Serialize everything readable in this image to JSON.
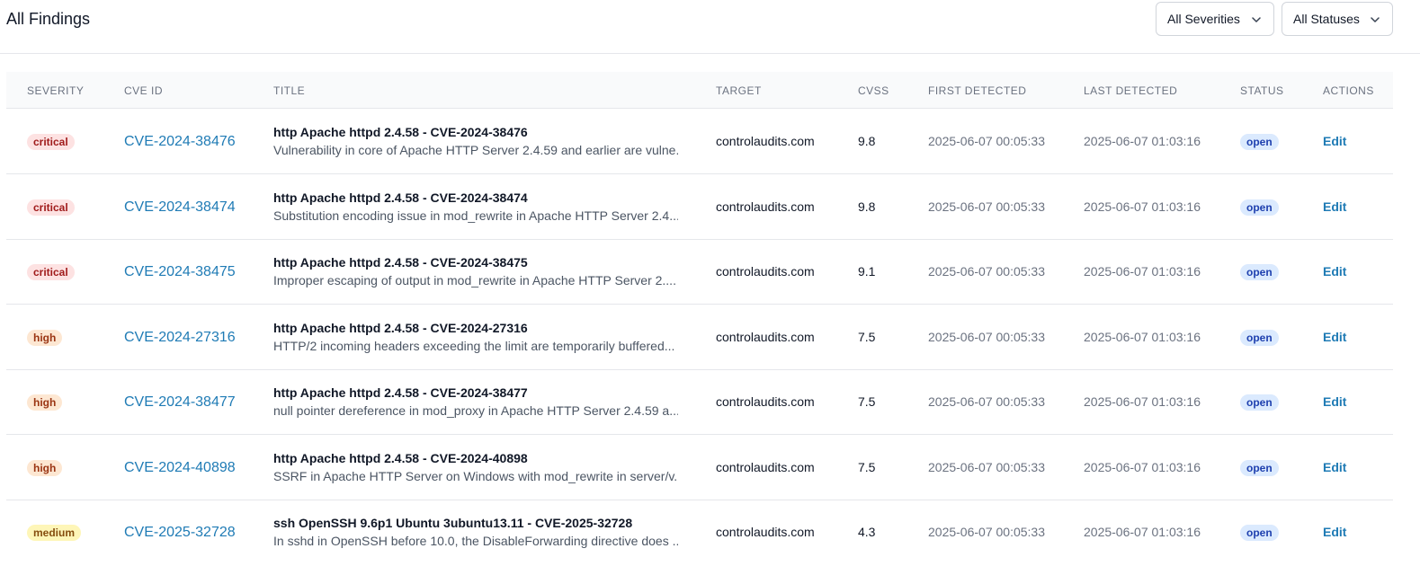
{
  "page": {
    "title": "All Findings"
  },
  "filters": {
    "severity": "All Severities",
    "status": "All Statuses"
  },
  "columns": {
    "severity": "SEVERITY",
    "cve_id": "CVE ID",
    "title": "TITLE",
    "target": "TARGET",
    "cvss": "CVSS",
    "first_detected": "FIRST DETECTED",
    "last_detected": "LAST DETECTED",
    "status": "STATUS",
    "actions": "ACTIONS"
  },
  "rows": [
    {
      "severity": "critical",
      "cve": "CVE-2024-38476",
      "title": "http Apache httpd 2.4.58 - CVE-2024-38476",
      "desc": "Vulnerability in core of Apache HTTP Server 2.4.59 and earlier are vulne...",
      "target": "controlaudits.com",
      "cvss": "9.8",
      "first": "2025-06-07 00:05:33",
      "last": "2025-06-07 01:03:16",
      "status": "open",
      "action": "Edit"
    },
    {
      "severity": "critical",
      "cve": "CVE-2024-38474",
      "title": "http Apache httpd 2.4.58 - CVE-2024-38474",
      "desc": "Substitution encoding issue in mod_rewrite in Apache HTTP Server 2.4....",
      "target": "controlaudits.com",
      "cvss": "9.8",
      "first": "2025-06-07 00:05:33",
      "last": "2025-06-07 01:03:16",
      "status": "open",
      "action": "Edit"
    },
    {
      "severity": "critical",
      "cve": "CVE-2024-38475",
      "title": "http Apache httpd 2.4.58 - CVE-2024-38475",
      "desc": "Improper escaping of output in mod_rewrite in Apache HTTP Server 2....",
      "target": "controlaudits.com",
      "cvss": "9.1",
      "first": "2025-06-07 00:05:33",
      "last": "2025-06-07 01:03:16",
      "status": "open",
      "action": "Edit"
    },
    {
      "severity": "high",
      "cve": "CVE-2024-27316",
      "title": "http Apache httpd 2.4.58 - CVE-2024-27316",
      "desc": "HTTP/2 incoming headers exceeding the limit are temporarily buffered...",
      "target": "controlaudits.com",
      "cvss": "7.5",
      "first": "2025-06-07 00:05:33",
      "last": "2025-06-07 01:03:16",
      "status": "open",
      "action": "Edit"
    },
    {
      "severity": "high",
      "cve": "CVE-2024-38477",
      "title": "http Apache httpd 2.4.58 - CVE-2024-38477",
      "desc": "null pointer dereference in mod_proxy in Apache HTTP Server 2.4.59 a...",
      "target": "controlaudits.com",
      "cvss": "7.5",
      "first": "2025-06-07 00:05:33",
      "last": "2025-06-07 01:03:16",
      "status": "open",
      "action": "Edit"
    },
    {
      "severity": "high",
      "cve": "CVE-2024-40898",
      "title": "http Apache httpd 2.4.58 - CVE-2024-40898",
      "desc": "SSRF in Apache HTTP Server on Windows with mod_rewrite in server/v...",
      "target": "controlaudits.com",
      "cvss": "7.5",
      "first": "2025-06-07 00:05:33",
      "last": "2025-06-07 01:03:16",
      "status": "open",
      "action": "Edit"
    },
    {
      "severity": "medium",
      "cve": "CVE-2025-32728",
      "title": "ssh OpenSSH 9.6p1 Ubuntu 3ubuntu13.11 - CVE-2025-32728",
      "desc": "In sshd in OpenSSH before 10.0, the DisableForwarding directive does ...",
      "target": "controlaudits.com",
      "cvss": "4.3",
      "first": "2025-06-07 00:05:33",
      "last": "2025-06-07 01:03:16",
      "status": "open",
      "action": "Edit"
    }
  ]
}
